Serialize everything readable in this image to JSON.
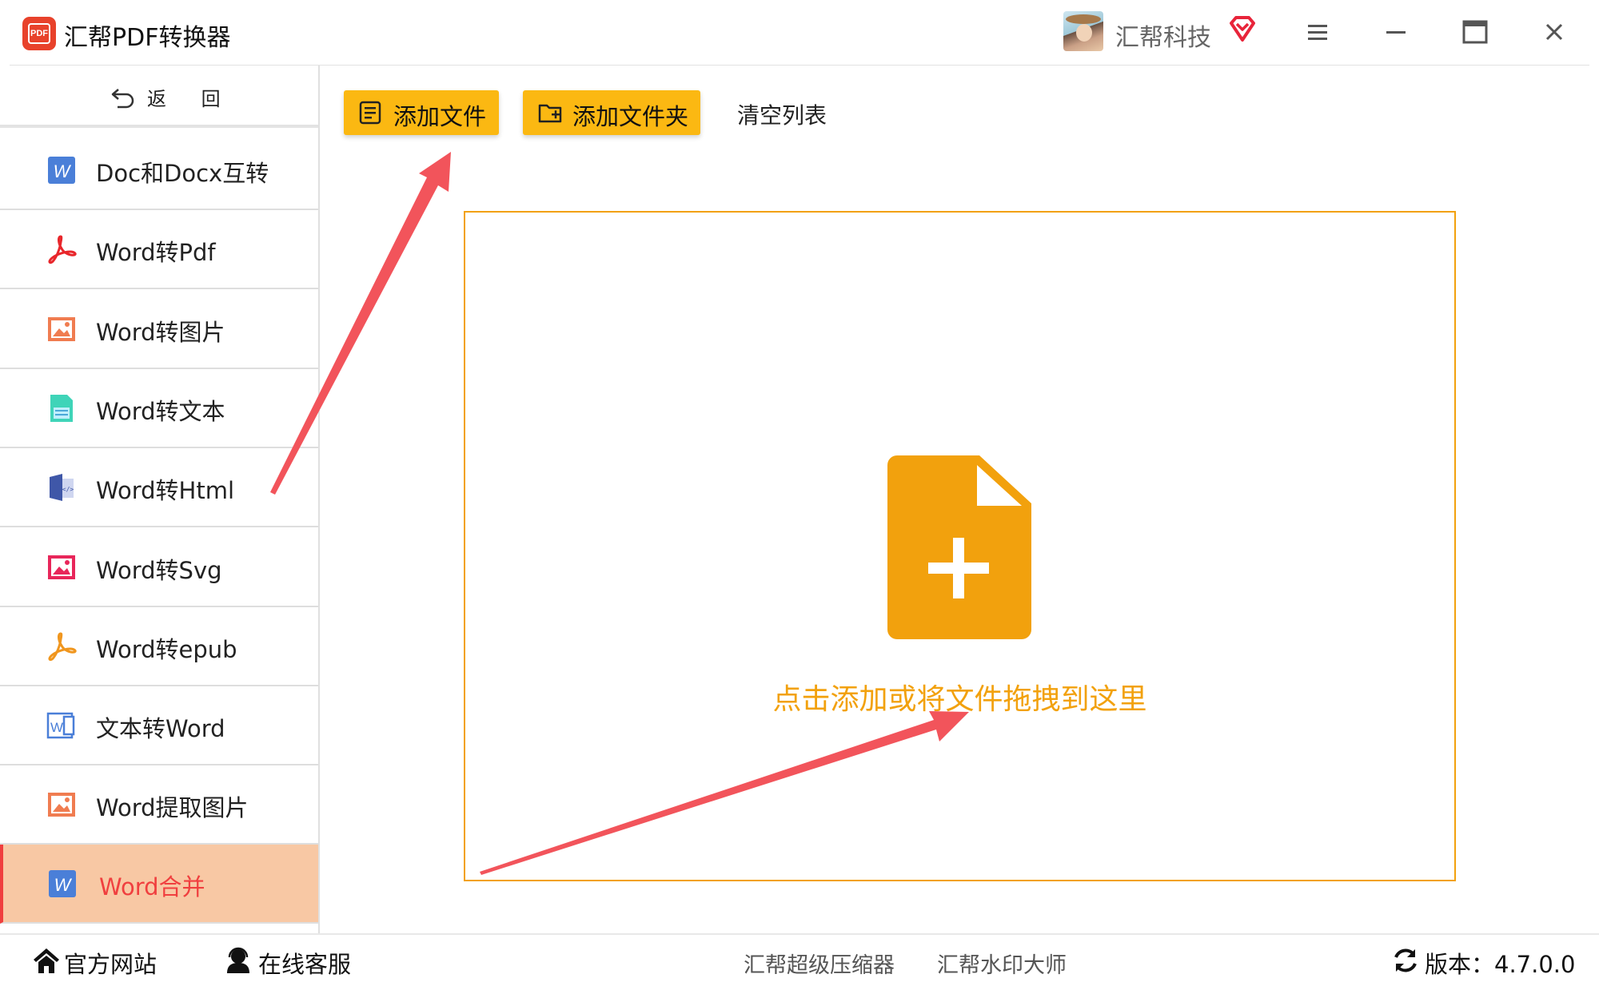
{
  "app": {
    "title": "汇帮PDF转换器",
    "icon_text": "PDF",
    "user_name": "汇帮科技"
  },
  "sidebar": {
    "back_label": "返 回",
    "items": [
      {
        "label": "Doc和Docx互转",
        "icon": "word-icon"
      },
      {
        "label": "Word转Pdf",
        "icon": "acrobat-icon"
      },
      {
        "label": "Word转图片",
        "icon": "image-icon"
      },
      {
        "label": "Word转文本",
        "icon": "text-document-icon"
      },
      {
        "label": "Word转Html",
        "icon": "html-book-icon"
      },
      {
        "label": "Word转Svg",
        "icon": "svg-image-icon"
      },
      {
        "label": "Word转epub",
        "icon": "acrobat-icon"
      },
      {
        "label": "文本转Word",
        "icon": "word-outline-icon"
      },
      {
        "label": "Word提取图片",
        "icon": "image-icon"
      },
      {
        "label": "Word合并",
        "icon": "word-icon",
        "active": true
      }
    ]
  },
  "toolbar": {
    "add_file": "添加文件",
    "add_folder": "添加文件夹",
    "clear_list": "清空列表"
  },
  "dropzone": {
    "hint": "点击添加或将文件拖拽到这里"
  },
  "bottom": {
    "website": "官方网站",
    "support": "在线客服",
    "link1": "汇帮超级压缩器",
    "link2": "汇帮水印大师",
    "version": "版本：4.7.0.0"
  },
  "colors": {
    "accent": "#fbb812",
    "drop_accent": "#f2a10d",
    "active_bg": "#f8c8a4",
    "active_text": "#f03f3f",
    "annotation_arrow": "#f2545b"
  }
}
